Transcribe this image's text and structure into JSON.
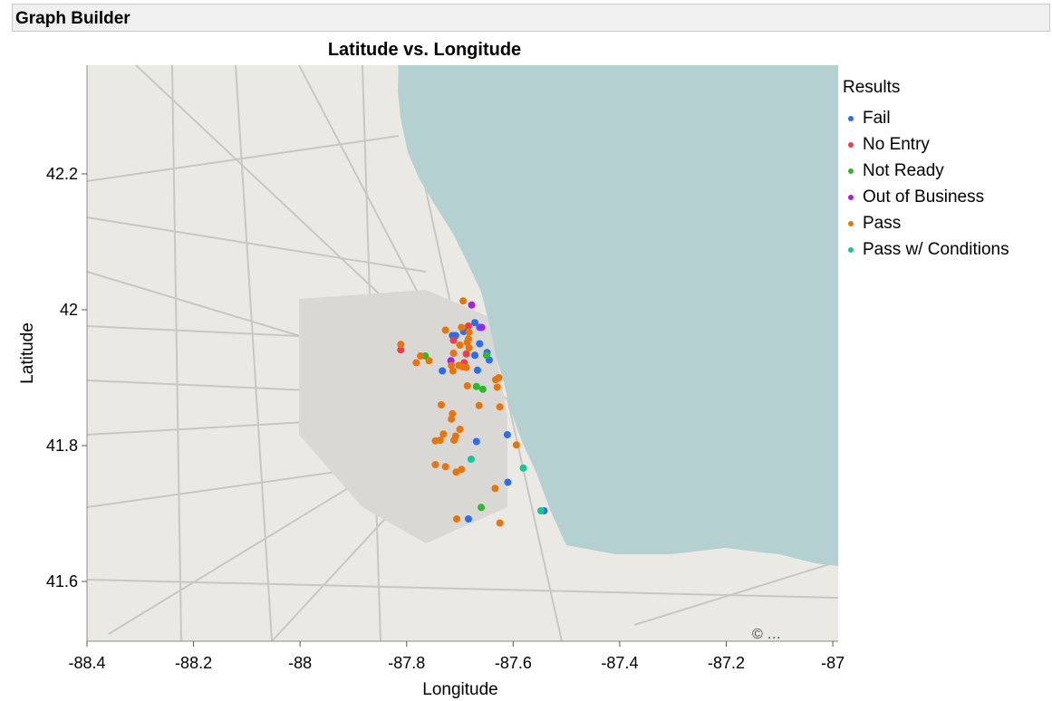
{
  "header": {
    "title": "Graph Builder"
  },
  "chart_data": {
    "type": "scatter",
    "title": "Latitude vs. Longitude",
    "xlabel": "Longitude",
    "ylabel": "Latitude",
    "xlim": [
      -88.4,
      -86.99
    ],
    "ylim": [
      41.512,
      42.36
    ],
    "xticks": [
      "-88.4",
      "-88.2",
      "-88",
      "-87.8",
      "-87.6",
      "-87.4",
      "-87.2",
      "-87"
    ],
    "yticks": [
      "41.6",
      "41.8",
      "42",
      "42.2"
    ],
    "background": "street map of Chicago area",
    "legend": {
      "title": "Results",
      "placement": "right"
    },
    "series": [
      {
        "name": "Fail",
        "color": "#2b6cf5",
        "points": [
          [
            -87.672,
            41.981
          ],
          [
            -87.663,
            41.974
          ],
          [
            -87.693,
            41.968
          ],
          [
            -87.714,
            41.962
          ],
          [
            -87.708,
            41.962
          ],
          [
            -87.663,
            41.95
          ],
          [
            -87.672,
            41.933
          ],
          [
            -87.649,
            41.937
          ],
          [
            -87.645,
            41.926
          ],
          [
            -87.733,
            41.91
          ],
          [
            -87.667,
            41.911
          ],
          [
            -87.669,
            41.806
          ],
          [
            -87.611,
            41.816
          ],
          [
            -87.61,
            41.746
          ],
          [
            -87.542,
            41.704
          ],
          [
            -87.684,
            41.692
          ]
        ]
      },
      {
        "name": "No Entry",
        "color": "#f03c46",
        "points": [
          [
            -87.684,
            41.976
          ],
          [
            -87.712,
            41.955
          ],
          [
            -87.811,
            41.941
          ],
          [
            -87.688,
            41.935
          ],
          [
            -87.692,
            41.922
          ]
        ]
      },
      {
        "name": "Not Ready",
        "color": "#2db82d",
        "points": [
          [
            -87.765,
            41.932
          ],
          [
            -87.65,
            41.933
          ],
          [
            -87.669,
            41.887
          ],
          [
            -87.657,
            41.883
          ],
          [
            -87.66,
            41.709
          ]
        ]
      },
      {
        "name": "Out of Business",
        "color": "#a020f0",
        "points": [
          [
            -87.678,
            42.007
          ],
          [
            -87.659,
            41.974
          ],
          [
            -87.717,
            41.925
          ]
        ]
      },
      {
        "name": "Pass",
        "color": "#e8740c",
        "points": [
          [
            -87.694,
            42.013
          ],
          [
            -87.697,
            41.974
          ],
          [
            -87.727,
            41.97
          ],
          [
            -87.683,
            41.967
          ],
          [
            -87.684,
            41.957
          ],
          [
            -87.686,
            41.952
          ],
          [
            -87.7,
            41.948
          ],
          [
            -87.683,
            41.944
          ],
          [
            -87.811,
            41.949
          ],
          [
            -87.774,
            41.932
          ],
          [
            -87.758,
            41.925
          ],
          [
            -87.782,
            41.922
          ],
          [
            -87.712,
            41.936
          ],
          [
            -87.716,
            41.918
          ],
          [
            -87.702,
            41.918
          ],
          [
            -87.695,
            41.916
          ],
          [
            -87.688,
            41.915
          ],
          [
            -87.713,
            41.91
          ],
          [
            -87.633,
            41.897
          ],
          [
            -87.627,
            41.9
          ],
          [
            -87.686,
            41.888
          ],
          [
            -87.63,
            41.886
          ],
          [
            -87.735,
            41.86
          ],
          [
            -87.664,
            41.859
          ],
          [
            -87.625,
            41.857
          ],
          [
            -87.714,
            41.847
          ],
          [
            -87.716,
            41.839
          ],
          [
            -87.7,
            41.824
          ],
          [
            -87.731,
            41.817
          ],
          [
            -87.708,
            41.814
          ],
          [
            -87.711,
            41.808
          ],
          [
            -87.746,
            41.807
          ],
          [
            -87.737,
            41.808
          ],
          [
            -87.594,
            41.801
          ],
          [
            -87.746,
            41.772
          ],
          [
            -87.727,
            41.769
          ],
          [
            -87.707,
            41.761
          ],
          [
            -87.697,
            41.765
          ],
          [
            -87.634,
            41.737
          ],
          [
            -87.706,
            41.692
          ],
          [
            -87.625,
            41.686
          ]
        ]
      },
      {
        "name": "Pass w/ Conditions",
        "color": "#14c896",
        "points": [
          [
            -87.679,
            41.78
          ],
          [
            -87.581,
            41.767
          ],
          [
            -87.548,
            41.704
          ]
        ]
      }
    ]
  }
}
